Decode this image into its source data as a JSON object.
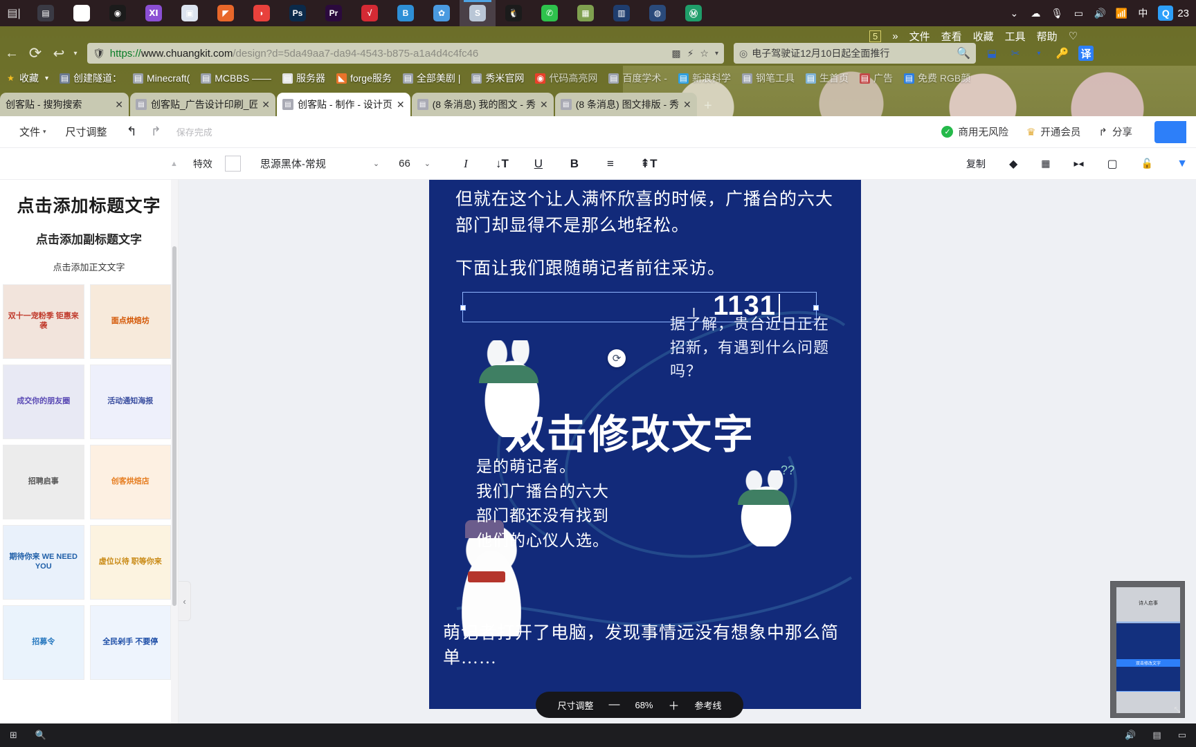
{
  "taskbar": {
    "start_icon": "windows-start-icon",
    "apps": [
      {
        "name": "app-icon-1",
        "glyph": "▤",
        "color": "#3a3a44"
      },
      {
        "name": "app-icon-evernote",
        "glyph": "❯",
        "color": "#ffffff"
      },
      {
        "name": "app-icon-location",
        "glyph": "◉",
        "color": "#1b1b1b"
      },
      {
        "name": "app-icon-visual-studio",
        "glyph": "Ⅺ",
        "color": "#8b4fd4"
      },
      {
        "name": "app-icon-notepad",
        "glyph": "▣",
        "color": "#dce3ef"
      },
      {
        "name": "app-icon-matlab",
        "glyph": "◤",
        "color": "#e8672a"
      },
      {
        "name": "app-icon-opera",
        "glyph": "◗",
        "color": "#e8413c"
      },
      {
        "name": "app-icon-photoshop",
        "glyph": "Ps",
        "color": "#0b2a4a"
      },
      {
        "name": "app-icon-premiere",
        "glyph": "Pr",
        "color": "#2b0a3d"
      },
      {
        "name": "app-icon-check",
        "glyph": "√",
        "color": "#d42a34"
      },
      {
        "name": "app-icon-baidu",
        "glyph": "B",
        "color": "#2e8fd6"
      },
      {
        "name": "app-icon-cloud",
        "glyph": "✿",
        "color": "#4a9ae0"
      },
      {
        "name": "app-icon-sogou",
        "glyph": "S",
        "color": "#b9c6d6"
      },
      {
        "name": "app-icon-qq",
        "glyph": "🐧",
        "color": "#1b1b1b"
      },
      {
        "name": "app-icon-wechat",
        "glyph": "✆",
        "color": "#2ec24c"
      },
      {
        "name": "app-icon-photo",
        "glyph": "▦",
        "color": "#7fa04f"
      },
      {
        "name": "app-icon-chart",
        "glyph": "▥",
        "color": "#1f3d6e"
      },
      {
        "name": "app-icon-globe",
        "glyph": "◍",
        "color": "#2a4a7a"
      },
      {
        "name": "app-icon-netease",
        "glyph": "Ⓜ",
        "color": "#1f9e6a"
      }
    ],
    "tray": [
      {
        "name": "tray-chevron-icon",
        "glyph": "⌄"
      },
      {
        "name": "tray-onedrive-icon",
        "glyph": "☁"
      },
      {
        "name": "tray-microphone-icon",
        "glyph": "🎙"
      },
      {
        "name": "tray-battery-icon",
        "glyph": "▭"
      },
      {
        "name": "tray-volume-icon",
        "glyph": "🔊"
      },
      {
        "name": "tray-wifi-icon",
        "glyph": "📶"
      },
      {
        "name": "tray-ime-icon",
        "glyph": "中"
      },
      {
        "name": "tray-qq-icon",
        "glyph": "Q"
      }
    ],
    "clock": "23"
  },
  "browser": {
    "nav": {
      "back_icon": "back-arrow-icon",
      "reload_icon": "reload-icon",
      "history_icon": "history-back-icon"
    },
    "omnibox": {
      "scheme": "https://",
      "host": "www.chuangkit.com",
      "path": "/design?d=5da49aa7-da94-4543-b875-a1a4d4c4fc46",
      "full_url": "https://www.chuangkit.com/design?d=5da49aa7-da94-4543-b875-a1a4d4c4fc46"
    },
    "search": {
      "value": "电子驾驶证12月10日起全面推行",
      "placeholder": "搜索"
    },
    "bookmarks": [
      {
        "label": "收藏",
        "icon": "star-icon",
        "icon_color": "#f7c020",
        "caret": true
      },
      {
        "label": "创建隧道：",
        "icon": "avatar-icon",
        "icon_color": "#6b7a8f"
      },
      {
        "label": "Minecraft(",
        "icon": "page-icon",
        "icon_color": "#9aa0ab"
      },
      {
        "label": "MCBBS ——",
        "icon": "page-icon",
        "icon_color": "#9aa0ab"
      },
      {
        "label": "服务器",
        "icon": "grid-icon",
        "icon_color": "#e0e0e0"
      },
      {
        "label": "forge服务",
        "icon": "forge-icon",
        "icon_color": "#e8732a"
      },
      {
        "label": "全部美剧 |",
        "icon": "page-icon",
        "icon_color": "#9aa0ab"
      },
      {
        "label": "秀米官网",
        "icon": "page-icon",
        "icon_color": "#9aa0ab"
      },
      {
        "label": "代码高亮网",
        "icon": "circle-icon",
        "icon_color": "#e8402a"
      },
      {
        "label": "百度学术 -",
        "icon": "page-icon",
        "icon_color": "#9aa0ab"
      },
      {
        "label": "新浪科学",
        "icon": "bird-icon",
        "icon_color": "#2e9fe0"
      },
      {
        "label": "钢笔工具",
        "icon": "page-icon",
        "icon_color": "#9aa0ab"
      },
      {
        "label": "生首页",
        "icon": "flower-icon",
        "icon_color": "#7fb3d5"
      },
      {
        "label": "广告",
        "icon": "page-icon",
        "icon_color": "#c34a4a"
      },
      {
        "label": "免费 RGB颜",
        "icon": "rgb-icon",
        "icon_color": "#2e7fe0"
      }
    ],
    "tabs": [
      {
        "label": "创客贴 - 搜狗搜索",
        "active": false,
        "close": "✕"
      },
      {
        "label": "创客贴_广告设计印刷_匠",
        "active": false,
        "close": "✕"
      },
      {
        "label": "创客贴 - 制作 - 设计页",
        "active": true,
        "close": "✕"
      },
      {
        "label": "(8 条消息) 我的图文 - 秀",
        "active": false,
        "close": "✕"
      },
      {
        "label": "(8 条消息) 图文排版 - 秀",
        "active": false,
        "close": "✕"
      }
    ],
    "new_tab": "+",
    "extensions": [
      {
        "name": "extension-translate-icon",
        "glyph": "译"
      },
      {
        "name": "extension-scissors-icon",
        "glyph": "✂"
      },
      {
        "name": "extension-key-icon",
        "glyph": "🔑"
      },
      {
        "name": "extension-download-icon",
        "glyph": "⬓"
      }
    ]
  },
  "explorer_menu": {
    "badge": "5",
    "chevron": "»",
    "items": [
      "文件",
      "查看",
      "收藏",
      "工具",
      "帮助"
    ],
    "shirt_icon": "shirt-icon"
  },
  "app": {
    "header": {
      "file_menu": "文件",
      "file_caret": "▾",
      "size_adjust": "尺寸调整",
      "undo_icon": "undo-icon",
      "redo_icon": "redo-icon",
      "save_state": "保存完成",
      "commercial_safe": "商用无风险",
      "open_vip": "开通会员",
      "share": "分享"
    },
    "format_bar": {
      "effect_label": "特效",
      "color_chip": "#ffffff",
      "font_family": "思源黑体-常规",
      "font_size": "66",
      "caret": "⌄",
      "icons": [
        {
          "name": "italic-icon",
          "glyph": "I"
        },
        {
          "name": "line-height-icon",
          "glyph": "↓T"
        },
        {
          "name": "underline-icon",
          "glyph": "U"
        },
        {
          "name": "bold-icon",
          "glyph": "B"
        },
        {
          "name": "align-icon",
          "glyph": "≡"
        },
        {
          "name": "letter-spacing-icon",
          "glyph": "↧T"
        }
      ],
      "right": {
        "copy_label": "复制",
        "icons": [
          {
            "name": "layers-icon",
            "glyph": "◆"
          },
          {
            "name": "transparency-icon",
            "glyph": "▒"
          },
          {
            "name": "flip-icon",
            "glyph": "▸◂"
          },
          {
            "name": "crop-icon",
            "glyph": "▢"
          },
          {
            "name": "lock-icon",
            "glyph": "🔓"
          },
          {
            "name": "trash-icon",
            "glyph": "▼"
          }
        ]
      }
    },
    "sidebar": {
      "title_placeholder": "点击添加标题文字",
      "subtitle_placeholder": "点击添加副标题文字",
      "body_placeholder": "点击添加正文文字",
      "collapse_icon": "‹",
      "thumbnails": [
        {
          "caption": "双十一宠粉季 钜惠来袭",
          "bg": "#f2e4dc",
          "color": "#c0392b"
        },
        {
          "caption": "面点烘焙坊",
          "bg": "#f7eadb",
          "color": "#d35400"
        },
        {
          "caption": "成交你的朋友圈",
          "bg": "#e8e9f4",
          "color": "#5b4bb5"
        },
        {
          "caption": "活动通知海报",
          "bg": "#eef0fb",
          "color": "#3b4fa0"
        },
        {
          "caption": "招聘启事",
          "bg": "#ececec",
          "color": "#555555"
        },
        {
          "caption": "创客烘焙店",
          "bg": "#fdf0e2",
          "color": "#e67e22"
        },
        {
          "caption": "期待你来 WE NEED YOU",
          "bg": "#e9f1fb",
          "color": "#1f5fa8"
        },
        {
          "caption": "虚位以待 职等你来",
          "bg": "#fcf3e0",
          "color": "#c98a16"
        },
        {
          "caption": "招募令",
          "bg": "#eaf3fc",
          "color": "#2a7ac0"
        },
        {
          "caption": "全民剁手 不要停",
          "bg": "#eef4fd",
          "color": "#1f4fa8"
        }
      ]
    },
    "canvas": {
      "paragraph_1": "但就在这个让人满怀欣喜的时候，广播台的六大部门却显得不是那么地轻松。",
      "paragraph_2": "下面让我们跟随萌记者前往采访。",
      "bubble_text": "据了解，贵台近日正在招新，有遇到什么问题吗？",
      "big_text": "双击修改文字",
      "paragraph_3": "是的萌记者。\n我们广播台的六大\n部门都还没有找到\n他们的心仪人选。",
      "bottom_text": "萌记者打开了电脑，发现事情远没有想象中那么简单……",
      "selected_text": "1131",
      "rotate_icon": "rotate-icon"
    },
    "zoombar": {
      "size_label": "尺寸调整",
      "minus": "—",
      "zoom": "68%",
      "plus": "＋",
      "guides": "参考线"
    },
    "preview": {
      "title": "诗人启事",
      "body": "双击修改文字",
      "expand_icon": "expand-icon"
    }
  },
  "ime_popup": {
    "mode": "中",
    "icons": [
      "◑",
      "⌨"
    ]
  },
  "bottom_strip": {
    "left_icons": [
      {
        "name": "windows-icon",
        "glyph": "⊞"
      },
      {
        "name": "search-icon",
        "glyph": "🔍"
      }
    ],
    "right_icons": [
      {
        "name": "speaker-icon",
        "glyph": "🔊"
      },
      {
        "name": "network-icon",
        "glyph": "▤"
      },
      {
        "name": "battery-icon",
        "glyph": "▭"
      }
    ]
  },
  "colors": {
    "canvas_blue": "#122a7a",
    "accent_blue": "#2d7ff9",
    "taskbar": "#2b1d20",
    "desktop": "#6a6d28"
  }
}
